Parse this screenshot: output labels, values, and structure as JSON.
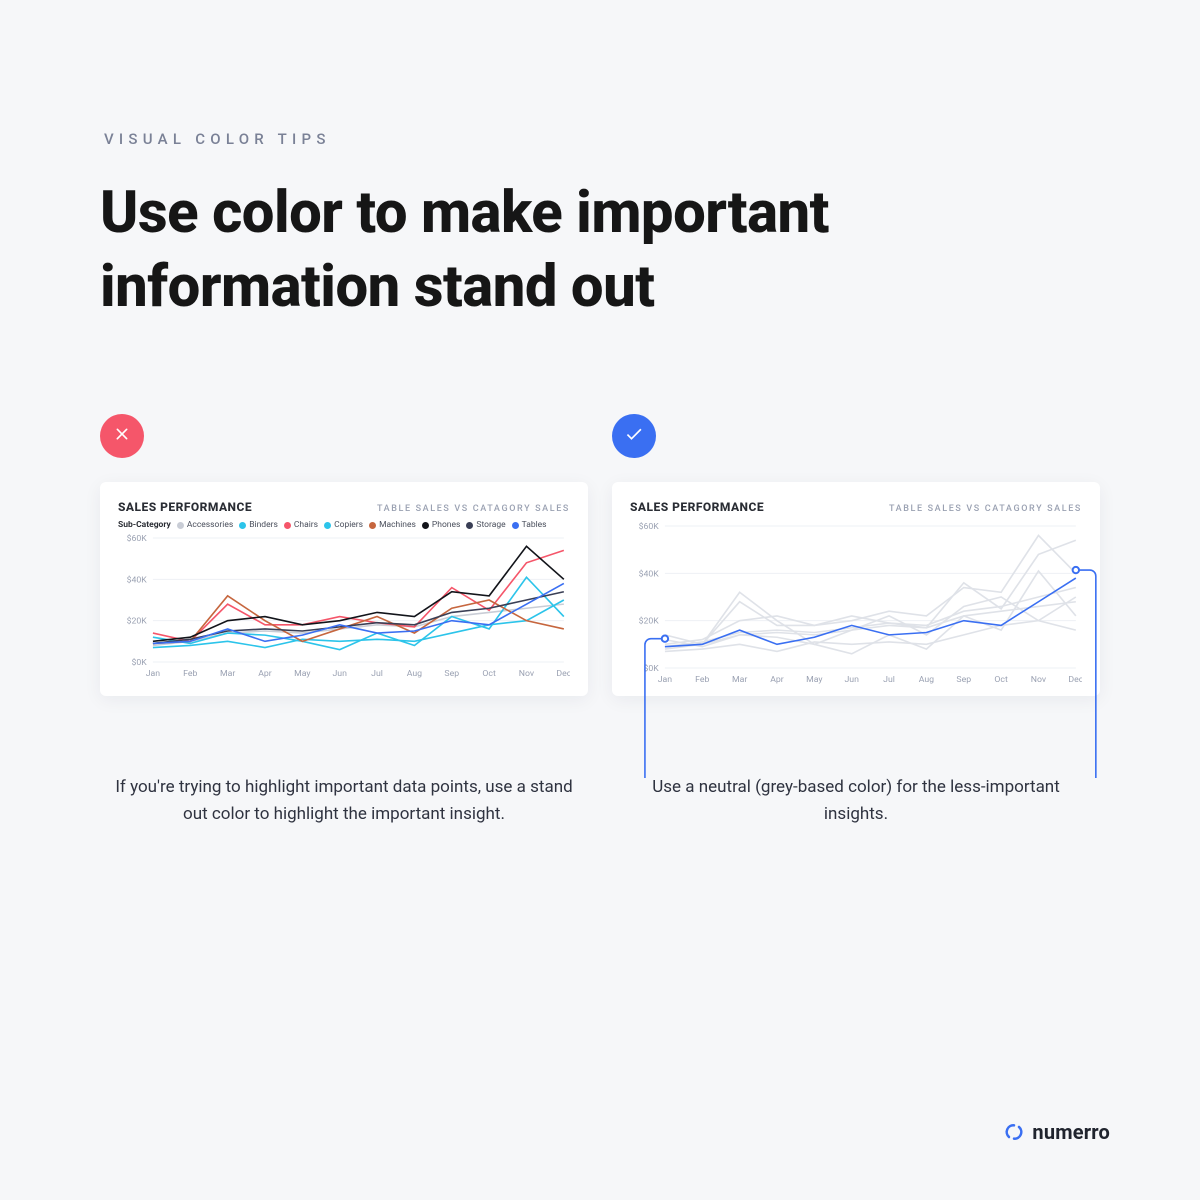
{
  "eyebrow": "VISUAL COLOR TIPS",
  "headline": "Use color to make important information stand out",
  "left": {
    "title": "SALES PERFORMANCE",
    "subtitle": "TABLE SALES VS CATAGORY SALES",
    "legend_label": "Sub-Category",
    "caption": "If you're trying to highlight important data points, use a stand out color to highlight the important insight."
  },
  "right": {
    "title": "SALES PERFORMANCE",
    "subtitle": "TABLE SALES VS CATAGORY SALES",
    "caption": "Use a neutral (grey-based color) for the less-important insights."
  },
  "footer": {
    "brand": "numerro"
  },
  "colors": {
    "Accessories": "#c9cdd6",
    "Binders": "#2cc4ea",
    "Chairs": "#f5566a",
    "Copiers": "#2cc4ea",
    "Machines": "#c6663e",
    "Phones": "#12141a",
    "Storage": "#3a3f55",
    "Tables": "#3a6ff2",
    "muted": "#dfe2e8",
    "highlight": "#3a6ff2"
  },
  "chart_data": [
    {
      "type": "line",
      "title": "SALES PERFORMANCE",
      "xlabel": "",
      "ylabel": "",
      "ylim": [
        0,
        60
      ],
      "yticks": [
        0,
        20,
        40,
        60
      ],
      "ytick_labels": [
        "$0K",
        "$20K",
        "$40K",
        "$60K"
      ],
      "categories": [
        "Jan",
        "Feb",
        "Mar",
        "Apr",
        "May",
        "Jun",
        "Jul",
        "Aug",
        "Sep",
        "Oct",
        "Nov",
        "Dec"
      ],
      "series": [
        {
          "name": "Accessories",
          "color": "#c9cdd6",
          "values": [
            8,
            10,
            14,
            15,
            14,
            16,
            18,
            17,
            22,
            24,
            26,
            28
          ]
        },
        {
          "name": "Binders",
          "color": "#2cc4ea",
          "values": [
            12,
            9,
            14,
            13,
            10,
            6,
            14,
            8,
            22,
            16,
            41,
            22
          ]
        },
        {
          "name": "Chairs",
          "color": "#f5566a",
          "values": [
            14,
            10,
            28,
            18,
            18,
            22,
            19,
            17,
            36,
            25,
            48,
            54
          ]
        },
        {
          "name": "Copiers",
          "color": "#2cc4ea",
          "values": [
            7,
            8,
            10,
            7,
            11,
            10,
            11,
            10,
            14,
            18,
            20,
            30
          ]
        },
        {
          "name": "Machines",
          "color": "#c6663e",
          "values": [
            9,
            10,
            32,
            20,
            10,
            16,
            22,
            14,
            26,
            30,
            20,
            16
          ]
        },
        {
          "name": "Phones",
          "color": "#12141a",
          "values": [
            10,
            12,
            20,
            22,
            18,
            20,
            24,
            22,
            34,
            32,
            56,
            40
          ]
        },
        {
          "name": "Storage",
          "color": "#3a3f55",
          "values": [
            9,
            11,
            15,
            16,
            15,
            17,
            19,
            18,
            24,
            26,
            30,
            34
          ]
        },
        {
          "name": "Tables",
          "color": "#3a6ff2",
          "values": [
            9,
            10,
            16,
            10,
            13,
            18,
            14,
            15,
            20,
            18,
            28,
            38
          ]
        }
      ]
    },
    {
      "type": "line",
      "title": "SALES PERFORMANCE",
      "xlabel": "",
      "ylabel": "",
      "ylim": [
        0,
        60
      ],
      "yticks": [
        0,
        20,
        40,
        60
      ],
      "ytick_labels": [
        "$0K",
        "$20K",
        "$40K",
        "$60K"
      ],
      "categories": [
        "Jan",
        "Feb",
        "Mar",
        "Apr",
        "May",
        "Jun",
        "Jul",
        "Aug",
        "Sep",
        "Oct",
        "Nov",
        "Dec"
      ],
      "highlight_series": "Tables",
      "series": [
        {
          "name": "Accessories",
          "color": "#dfe2e8",
          "values": [
            8,
            10,
            14,
            15,
            14,
            16,
            18,
            17,
            22,
            24,
            26,
            28
          ]
        },
        {
          "name": "Binders",
          "color": "#dfe2e8",
          "values": [
            12,
            9,
            14,
            13,
            10,
            6,
            14,
            8,
            22,
            16,
            41,
            22
          ]
        },
        {
          "name": "Chairs",
          "color": "#dfe2e8",
          "values": [
            14,
            10,
            28,
            18,
            18,
            22,
            19,
            17,
            36,
            25,
            48,
            54
          ]
        },
        {
          "name": "Copiers",
          "color": "#dfe2e8",
          "values": [
            7,
            8,
            10,
            7,
            11,
            10,
            11,
            10,
            14,
            18,
            20,
            30
          ]
        },
        {
          "name": "Machines",
          "color": "#dfe2e8",
          "values": [
            9,
            10,
            32,
            20,
            10,
            16,
            22,
            14,
            26,
            30,
            20,
            16
          ]
        },
        {
          "name": "Phones",
          "color": "#dfe2e8",
          "values": [
            10,
            12,
            20,
            22,
            18,
            20,
            24,
            22,
            34,
            32,
            56,
            40
          ]
        },
        {
          "name": "Storage",
          "color": "#dfe2e8",
          "values": [
            9,
            11,
            15,
            16,
            15,
            17,
            19,
            18,
            24,
            26,
            30,
            34
          ]
        },
        {
          "name": "Tables",
          "color": "#3a6ff2",
          "values": [
            9,
            10,
            16,
            10,
            13,
            18,
            14,
            15,
            20,
            18,
            28,
            38
          ]
        }
      ]
    }
  ]
}
